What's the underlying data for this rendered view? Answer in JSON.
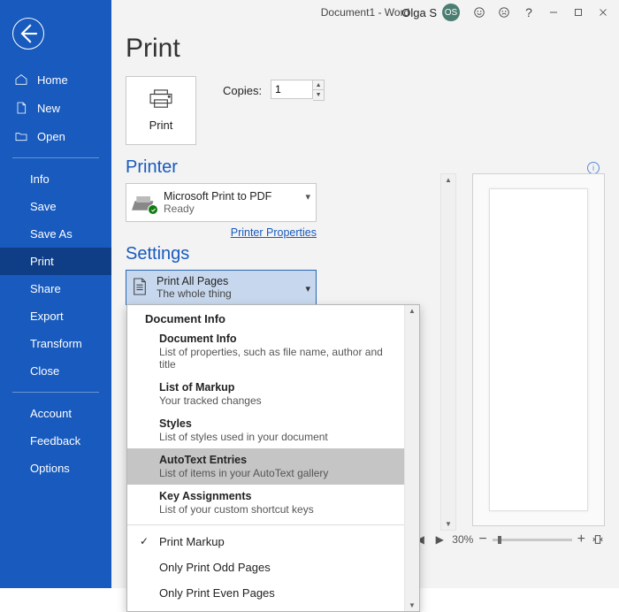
{
  "titlebar": {
    "title": "Document1  -  Word",
    "user_name": "Olga S",
    "user_initials": "OS"
  },
  "sidebar": {
    "groups": [
      {
        "items": [
          {
            "label": "Home",
            "icon": "home"
          },
          {
            "label": "New",
            "icon": "new"
          },
          {
            "label": "Open",
            "icon": "open"
          }
        ]
      },
      {
        "items": [
          {
            "label": "Info"
          },
          {
            "label": "Save"
          },
          {
            "label": "Save As"
          },
          {
            "label": "Print",
            "selected": true
          },
          {
            "label": "Share"
          },
          {
            "label": "Export"
          },
          {
            "label": "Transform"
          },
          {
            "label": "Close"
          }
        ]
      },
      {
        "items": [
          {
            "label": "Account"
          },
          {
            "label": "Feedback"
          },
          {
            "label": "Options"
          }
        ]
      }
    ]
  },
  "page": {
    "title": "Print",
    "print_button": "Print",
    "copies_label": "Copies:",
    "copies_value": "1",
    "printer_header": "Printer",
    "printer_name": "Microsoft Print to PDF",
    "printer_status": "Ready",
    "printer_properties": "Printer Properties",
    "settings_header": "Settings",
    "settings_value_line1": "Print All Pages",
    "settings_value_line2": "The whole thing"
  },
  "dropdown": {
    "header": "Document Info",
    "items": [
      {
        "title": "Document Info",
        "sub": "List of properties, such as file name, author and title"
      },
      {
        "title": "List of Markup",
        "sub": "Your tracked changes"
      },
      {
        "title": "Styles",
        "sub": "List of styles used in your document"
      },
      {
        "title": "AutoText Entries",
        "sub": "List of items in your AutoText gallery",
        "hover": true
      },
      {
        "title": "Key Assignments",
        "sub": "List of your custom shortcut keys"
      }
    ],
    "options": [
      {
        "label": "Print Markup",
        "checked": true
      },
      {
        "label": "Only Print Odd Pages"
      },
      {
        "label": "Only Print Even Pages"
      }
    ]
  },
  "zoom": {
    "nav_left": "◀",
    "nav_right": "▶",
    "percent": "30%",
    "minus": "−",
    "plus": "+"
  }
}
